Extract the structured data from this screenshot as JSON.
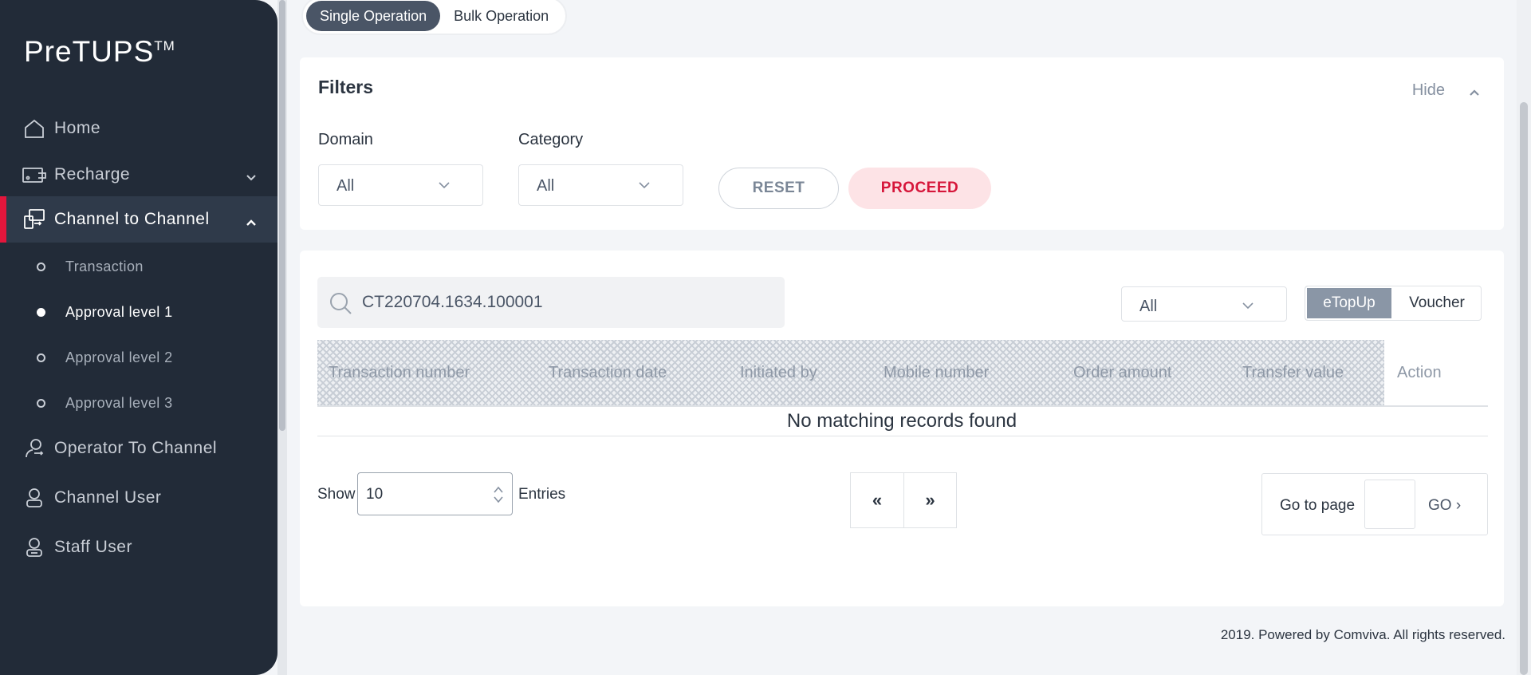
{
  "app": {
    "logo": "PreTUPS",
    "logo_tm": "TM"
  },
  "sidebar": {
    "items": [
      {
        "label": "Home"
      },
      {
        "label": "Recharge"
      },
      {
        "label": "Channel to Channel"
      },
      {
        "label": "Operator To Channel"
      },
      {
        "label": "Channel User"
      },
      {
        "label": "Staff User"
      }
    ],
    "sub_items": [
      {
        "label": "Transaction"
      },
      {
        "label": "Approval level 1"
      },
      {
        "label": "Approval level 2"
      },
      {
        "label": "Approval level 3"
      }
    ]
  },
  "operation_tabs": {
    "single": "Single Operation",
    "bulk": "Bulk Operation"
  },
  "filters": {
    "title": "Filters",
    "hide_label": "Hide",
    "domain_label": "Domain",
    "domain_value": "All",
    "category_label": "Category",
    "category_value": "All",
    "reset_label": "RESET",
    "proceed_label": "PROCEED"
  },
  "results": {
    "search_value": "CT220704.1634.100001",
    "type_value": "All",
    "toggle": {
      "active": "eTopUp",
      "inactive": "Voucher"
    },
    "columns": [
      "Transaction number",
      "Transaction date",
      "Initiated by",
      "Mobile number",
      "Order amount",
      "Transfer value",
      "Action"
    ],
    "empty_message": "No matching records found",
    "show_label": "Show",
    "entries_value": "10",
    "entries_label": "Entries",
    "prev_label": "«",
    "next_label": "»",
    "goto_label": "Go to page",
    "go_label": "GO ›"
  },
  "footer": {
    "text": "2019. Powered by Comviva. All rights reserved."
  },
  "colors": {
    "sidebar_bg": "#222b38",
    "accent": "#e3163c",
    "proceed_bg": "#fde3e6",
    "active_tab": "#4a5566",
    "toggle_active": "#8a96a6"
  }
}
